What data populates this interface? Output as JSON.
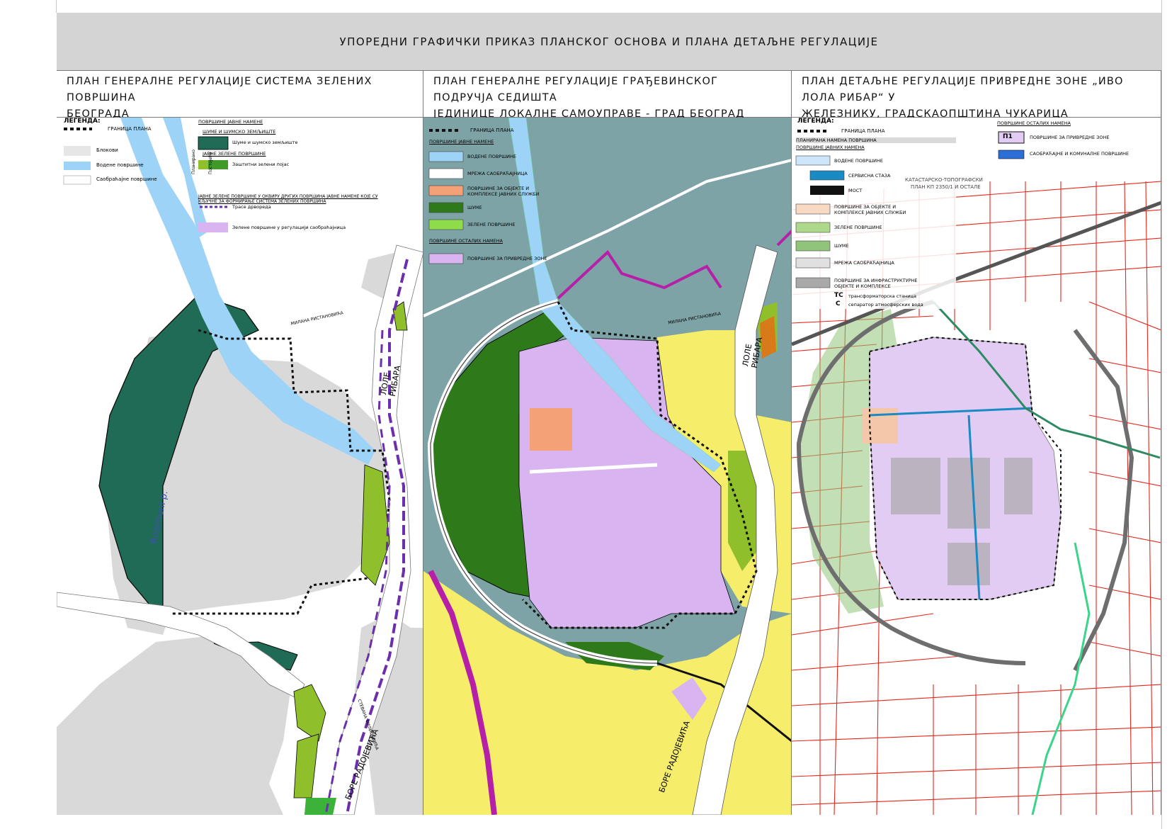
{
  "title": "УПОРЕДНИ ГРАФИЧКИ ПРИКАЗ ПЛАНСКОГ ОСНОВА И ПЛАНА ДЕТАЉНЕ РЕГУЛАЦИЈЕ",
  "panel1": {
    "heading_line1": "ПЛАН ГЕНЕРАЛНЕ РЕГУЛАЦИЈЕ СИСТЕМА ЗЕЛЕНИХ ПОВРШИНА",
    "heading_line2": "БЕОГРАДА",
    "legend_title": "ЛЕГЕНДА:",
    "boundary": "ГРАНИЦА ПЛАНА",
    "blocks": "Блокови",
    "water": "Водене површине",
    "traffic": "Саобраћајне површине",
    "public_use": "ПОВРШИНЕ ЈАВНЕ НАМЕНЕ",
    "forest_group": "ШУМЕ И ШУМСКО ЗЕМЉИШТЕ",
    "forest": "Шуме и шумско земљиште",
    "green_group": "ЈАВНЕ ЗЕЛЕНЕ ПОВРШИНЕ",
    "protective": "Заштитни зелени појас",
    "vert_planned": "Планирано",
    "vert_existing": "Постојеће",
    "other_green": "ЈАВНЕ ЗЕЛЕНЕ ПОВРШИНЕ У ОКВИРУ ДРУГИХ ПОВРШИНА ЈАВНЕ НАМЕНЕ КОЈЕ СУ КЉУЧНЕ ЗА ФОРМИРАЊЕ СИСТЕМА ЗЕЛЕНИХ ПОВРШИНА",
    "tree_rows": "Трасе дрвореда",
    "green_traffic": "Зелене површине у регулацији саобраћајница",
    "map_label_stream": "Bezimeni p.",
    "map_label_road1": "ЛОЛЕ РИБАРА",
    "map_label_road2": "БОРЕ РАДОЈЕВИЋА",
    "map_label_road3": "МИЛАНА РИСТАНОВИЋА",
    "map_label_road4": "СТЕВАНА ФИЛИПОВИЋА"
  },
  "panel2": {
    "heading_line1": "ПЛАН ГЕНЕРАЛНЕ РЕГУЛАЦИЈЕ ГРАЂЕВИНСКОГ ПОДРУЧЈА СЕДИШТА",
    "heading_line2": "ЈЕДИНИЦЕ ЛОКАЛНЕ САМОУПРАВЕ - ГРАД БЕОГРАД (ЦЕЛИНЕ I - XIX)",
    "boundary": "ГРАНИЦА ПЛАНА",
    "public_use": "ПОВРШИНЕ ЈАВНЕ НАМЕНЕ",
    "water": "ВОДЕНЕ ПОВРШИНЕ",
    "traffic": "МРЕЖА САОБРАЋАЈНИЦА",
    "services": "ПОВРШИНЕ ЗА ОБЈЕКТЕ И КОМПЛЕКСЕ ЈАВНИХ СЛУЖБИ",
    "forests": "ШУМЕ",
    "green": "ЗЕЛЕНЕ ПОВРШИНЕ",
    "other_use": "ПОВРШИНЕ ОСТАЛИХ НАМЕНА",
    "commercial": "ПОВРШИНЕ ЗА ПРИВРЕДНЕ ЗОНЕ",
    "map_label_road1": "ЛОЛЕ РИБАРА",
    "map_label_road2": "БОРЕ РАДОЈЕВИЋА",
    "map_label_road3": "МИЛАНА РИСТАНОВИЋА"
  },
  "panel3": {
    "heading_line1": "ПЛАН ДЕТАЉНЕ РЕГУЛАЦИЈЕ ПРИВРЕДНЕ ЗОНЕ „ИВО ЛОЛА РИБАР“ У",
    "heading_line2": "ЖЕЛЕЗНИКУ, ГРАДСКАОПШТИНА ЧУКАРИЦА",
    "legend_title": "ЛЕГЕНДА:",
    "boundary": "ГРАНИЦА ПЛАНА",
    "planned_use": "ПЛАНИРАНА НАМЕНА ПОВРШИНА",
    "public_use": "ПОВРШИНЕ ЈАВНИХ НАМЕНА",
    "water": "ВОДЕНЕ ПОВРШИНЕ",
    "service_path": "СЕРВИСНА СТАЗА",
    "bridge": "МОСТ",
    "public_services": "ПОВРШИНЕ ЗА ОБЈЕКТЕ И КОМПЛЕКСЕ ЈАВНИХ СЛУЖБИ",
    "green": "ЗЕЛЕНЕ ПОВРШИНЕ",
    "forests": "ШУМЕ",
    "traffic_network": "МРЕЖА САОБРАЋАЈНИЦА",
    "infrastructure": "ПОВРШИНЕ ЗА ИНФРАСТРУКТУРНЕ ОБЈЕКТЕ И КОМПЛЕКСЕ",
    "tc_symbol": "ТС",
    "tc_label": "трансформаторска станица",
    "c_symbol": "С",
    "c_label": "сепаратор атмосферских вода",
    "other_use": "ПОВРШИНЕ ОСТАЛИХ НАМЕНА",
    "p1_symbol": "П1",
    "commercial": "ПОВРШИНЕ ЗА ПРИВРЕДНЕ ЗОНЕ",
    "traffic_utility": "САОБРАЋАЈНЕ И КОМУНАЛНЕ ПОВРШИНЕ",
    "cadastre_line1": "КАТАСТАРСКО-ТОПОГРАФСКИ",
    "cadastre_line2": "ПЛАН КП 2350/1 И ОСТАЛЕ"
  },
  "colors": {
    "water": "#9cd3f7",
    "block": "#d9d9d9",
    "forest": "#1f6b56",
    "green_lime": "#8fbf2a",
    "purple_line": "#6b2fae",
    "lilac": "#d8b5f0",
    "teal_bg": "#7da3a6",
    "forest2": "#2e7a1a",
    "yellow": "#f6ee6a",
    "salmon": "#f4a178",
    "magenta": "#b620a9",
    "cadastre_red": "#e4281c",
    "service_blue": "#1a8ac5"
  }
}
